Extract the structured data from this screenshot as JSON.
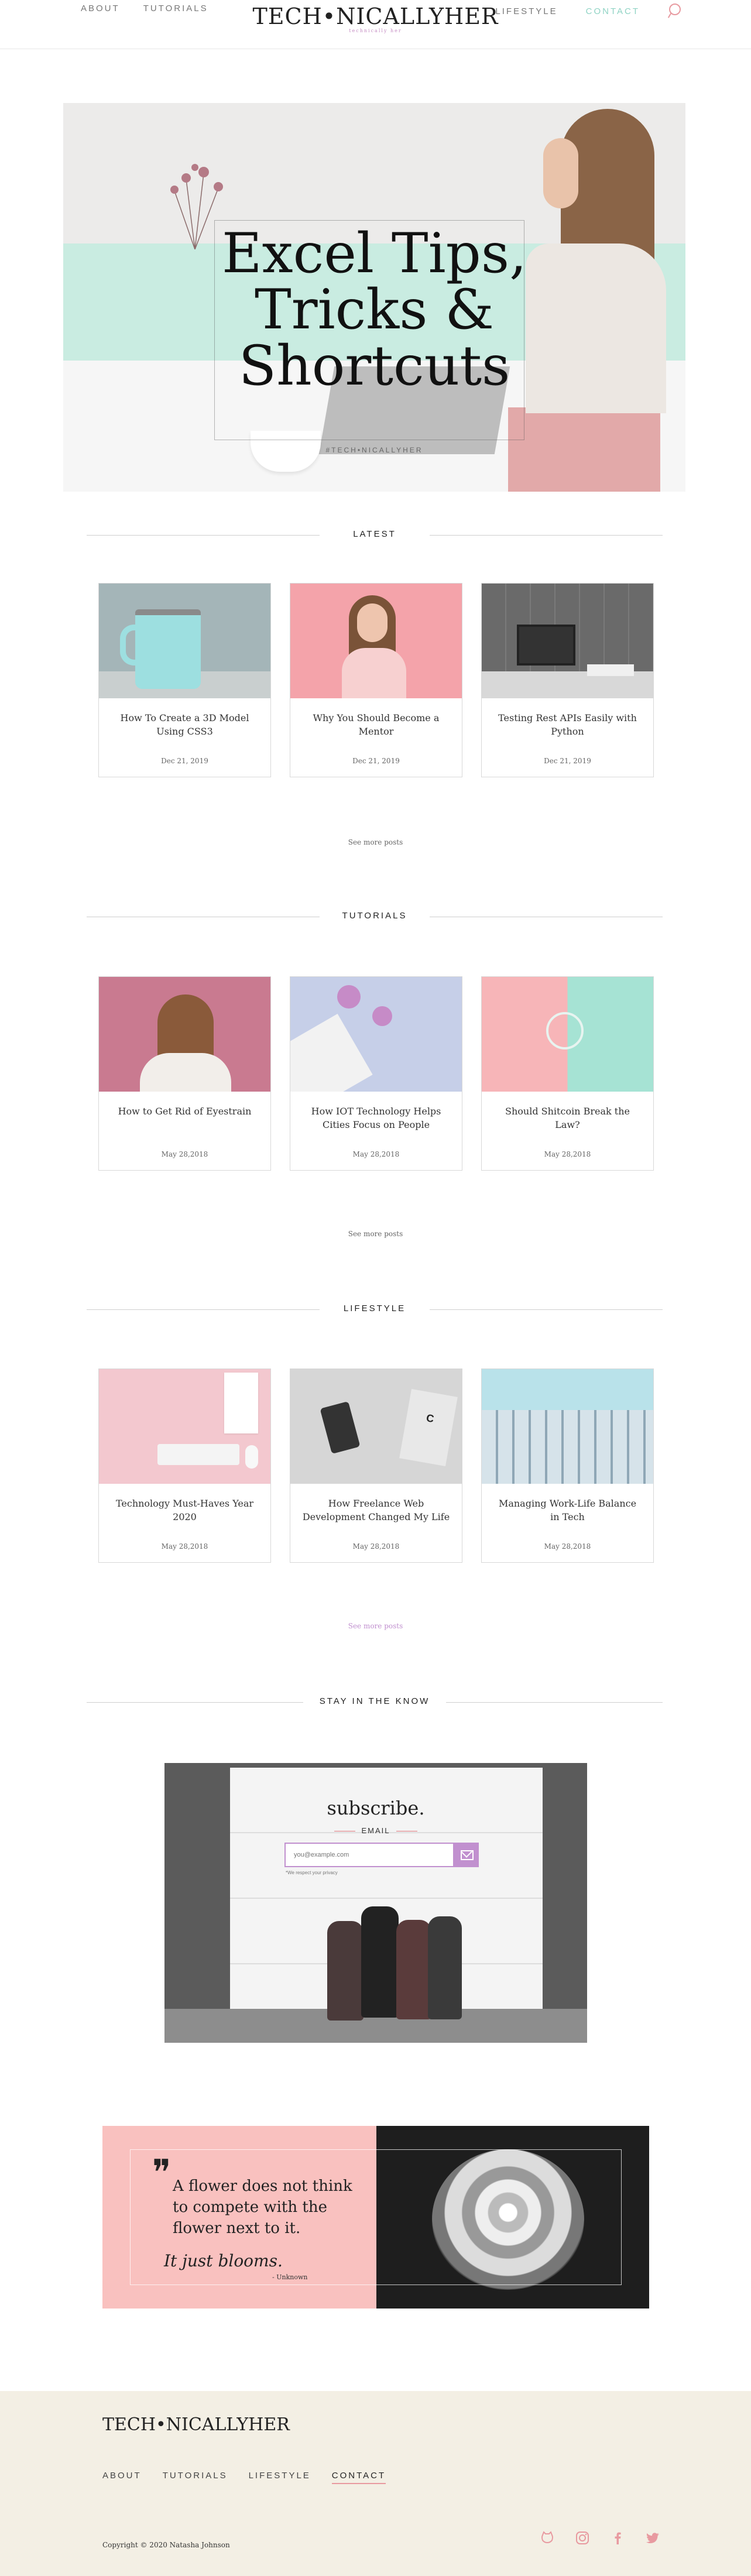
{
  "header": {
    "nav_left": [
      "ABOUT",
      "TUTORIALS"
    ],
    "nav_right": [
      "LIFESTYLE",
      "CONTACT"
    ],
    "logo": "TECH•NICALLYHER",
    "logo_sub": "technically her"
  },
  "hero": {
    "title_line1": "Excel Tips,",
    "title_line2": "Tricks &",
    "title_line3": "Shortcuts",
    "tag": "#TECH•NICALLYHER"
  },
  "latest": {
    "heading": "LATEST",
    "posts": [
      {
        "title": "How To Create a 3D Model Using CSS3",
        "date": "Dec 21, 2019"
      },
      {
        "title": "Why You Should Become a Mentor",
        "date": "Dec 21, 2019"
      },
      {
        "title": "Testing Rest APIs Easily with Python",
        "date": "Dec 21, 2019"
      }
    ],
    "more": "See more posts"
  },
  "tutorials": {
    "heading": "TUTORIALS",
    "posts": [
      {
        "title": "How to Get Rid of Eyestrain",
        "date": "May 28,2018"
      },
      {
        "title": "How IOT Technology Helps Cities Focus on People",
        "date": "May 28,2018"
      },
      {
        "title": "Should Shitcoin Break the Law?",
        "date": "May 28,2018"
      }
    ],
    "more": "See more posts"
  },
  "lifestyle": {
    "heading": "LIFESTYLE",
    "posts": [
      {
        "title": "Technology Must-Haves Year 2020",
        "date": "May 28,2018"
      },
      {
        "title": "How Freelance Web Development Changed My Life",
        "date": "May 28,2018"
      },
      {
        "title": "Managing Work-Life Balance in Tech",
        "date": "May 28,2018"
      }
    ],
    "more": "See more posts"
  },
  "subscribe": {
    "heading": "STAY IN THE KNOW",
    "title": "subscribe.",
    "label": "EMAIL",
    "placeholder": "you@example.com",
    "note": "*We respect your privacy"
  },
  "quote": {
    "mark": "❞",
    "text": "A flower does not think to compete with the flower next to it.",
    "script": "It just blooms.",
    "author": "- Unknown"
  },
  "footer": {
    "logo": "TECH•NICALLYHER",
    "nav": [
      "ABOUT",
      "TUTORIALS",
      "LIFESTYLE",
      "CONTACT"
    ],
    "copyright": "Copyright © 2020 Natasha Johnson",
    "social": [
      "github-icon",
      "instagram-icon",
      "facebook-icon",
      "twitter-icon"
    ]
  },
  "colors": {
    "accent_pink": "#e89aa0",
    "accent_mint": "#8fd3c4",
    "accent_purple": "#c190cf",
    "footer_bg": "#f3efe4"
  }
}
